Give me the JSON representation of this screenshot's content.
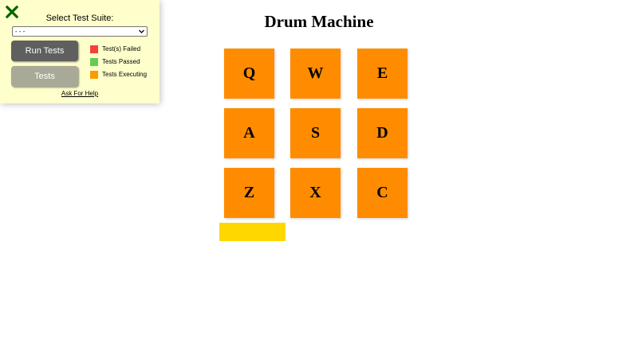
{
  "test_panel": {
    "close_icon": "close-x-icon",
    "close_color": "#006400",
    "suite_label": "Select Test Suite:",
    "suite_selected": "- - -",
    "run_tests_label": "Run Tests",
    "tests_label": "Tests",
    "legend": [
      {
        "label": "Test(s) Failed",
        "color": "#f44336"
      },
      {
        "label": "Tests Passed",
        "color": "#66cc55"
      },
      {
        "label": "Tests Executing",
        "color": "#ff9900"
      }
    ],
    "help_link": "Ask For Help"
  },
  "drum_machine": {
    "title": "Drum Machine",
    "pad_color": "#ff8c00",
    "display_color": "#ffd700",
    "display_text": "",
    "pads": [
      "Q",
      "W",
      "E",
      "A",
      "S",
      "D",
      "Z",
      "X",
      "C"
    ]
  }
}
